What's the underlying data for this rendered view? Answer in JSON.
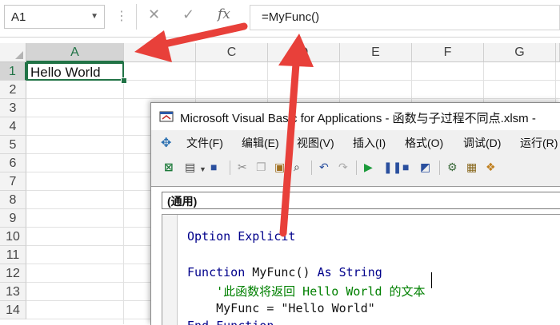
{
  "formula_bar": {
    "name_box": "A1",
    "cancel_glyph": "✕",
    "enter_glyph": "✓",
    "fx_label": "fx",
    "formula": "=MyFunc()"
  },
  "sheet": {
    "columns": [
      "A",
      "B",
      "C",
      "D",
      "E",
      "F",
      "G"
    ],
    "rows": [
      "1",
      "2",
      "3",
      "4",
      "5",
      "6",
      "7",
      "8",
      "9",
      "10",
      "11",
      "12",
      "13",
      "14"
    ],
    "selected_cell": "A1",
    "cell_a1_value": "Hello World"
  },
  "vba": {
    "title": "Microsoft Visual Basic for Applications - 函数与子过程不同点.xlsm -",
    "menus": [
      "文件(F)",
      "编辑(E)",
      "视图(V)",
      "插入(I)",
      "格式(O)",
      "调试(D)",
      "运行(R)"
    ],
    "procedure_combo": "(通用)",
    "code_lines": [
      {
        "tokens": [
          {
            "t": "Option Explicit",
            "c": "kw"
          }
        ]
      },
      {
        "tokens": []
      },
      {
        "tokens": [
          {
            "t": "Function ",
            "c": "kw"
          },
          {
            "t": "MyFunc() ",
            "c": "tx"
          },
          {
            "t": "As String",
            "c": "kw"
          }
        ]
      },
      {
        "tokens": [
          {
            "t": "    '此函数将返回 Hello World 的文本",
            "c": "cm"
          }
        ]
      },
      {
        "tokens": [
          {
            "t": "    MyFunc = \"Hello World\"",
            "c": "tx"
          }
        ]
      },
      {
        "tokens": [
          {
            "t": "End Function",
            "c": "kw"
          }
        ]
      }
    ]
  },
  "colors": {
    "excel_green": "#217346",
    "arrow_red": "#e8403a",
    "keyword_blue": "#00008b",
    "comment_green": "#008000"
  }
}
